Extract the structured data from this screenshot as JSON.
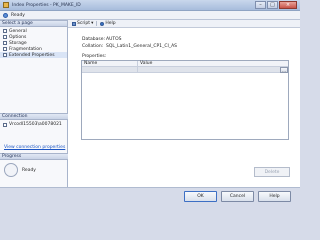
{
  "window": {
    "title": "Index Properties - PK_MAKE_ID",
    "status": "Ready"
  },
  "sidebar": {
    "pages_header": "Select a page",
    "pages": [
      {
        "label": "General"
      },
      {
        "label": "Options"
      },
      {
        "label": "Storage"
      },
      {
        "label": "Fragmentation"
      },
      {
        "label": "Extended Properties"
      }
    ],
    "connection_header": "Connection",
    "connection_value": "Vrcodl15503\\a0078021",
    "view_connection_link": "View connection properties",
    "progress_header": "Progress",
    "progress_status": "Ready"
  },
  "toolbar": {
    "script_label": "Script",
    "help_label": "Help"
  },
  "main": {
    "database_label": "Database:",
    "database_value": "AUTOS",
    "collation_label": "Collation:",
    "collation_value": "SQL_Latin1_General_CP1_CI_AS",
    "properties_label": "Properties:",
    "grid_columns": [
      "Name",
      "Value"
    ],
    "ellipsis": "...",
    "delete_label": "Delete"
  },
  "footer": {
    "ok_label": "OK",
    "cancel_label": "Cancel",
    "help_label": "Help"
  },
  "colors": {
    "accent": "#3d6fc4",
    "link": "#1b55c4"
  }
}
